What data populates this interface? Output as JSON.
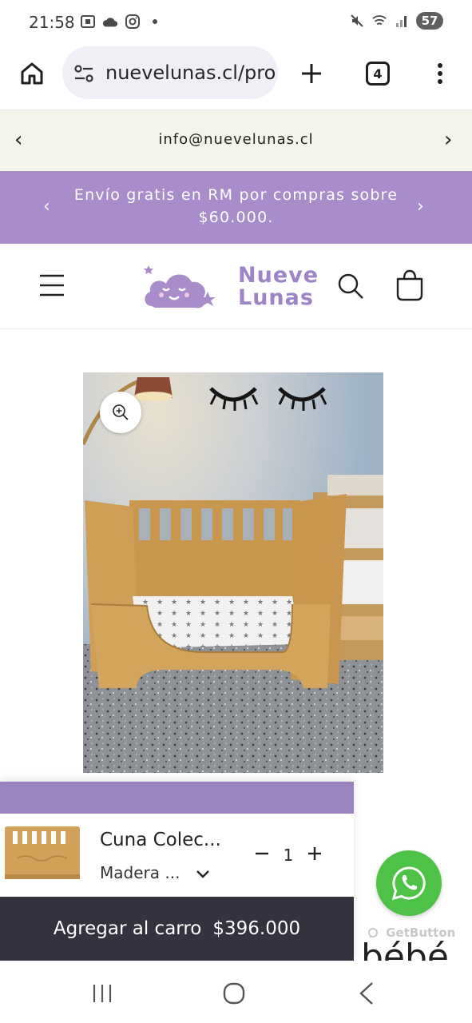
{
  "status_bar": {
    "time": "21:58",
    "battery": "57",
    "left_icons": [
      "screenshot-icon",
      "cloud-icon",
      "instagram-icon",
      "dot-icon"
    ],
    "right_icons": [
      "mute-icon",
      "wifi-icon",
      "signal-icon"
    ]
  },
  "browser": {
    "url": "nuevelunas.cl/pro",
    "tab_count": "4"
  },
  "announcement_1": {
    "text": "info@nuevelunas.cl",
    "prev": "‹",
    "next": "›"
  },
  "announcement_2": {
    "text": "Envío gratis en RM por compras sobre $60.000.",
    "prev": "‹",
    "next": "›"
  },
  "header": {
    "logo_text_line1": "Nueve",
    "logo_text_line2": "Lunas"
  },
  "product": {
    "image_icon": "crib-photo",
    "partial_heading": "bébé"
  },
  "sticky_cart": {
    "name": "Cuna Colec...",
    "variant": "Madera ...",
    "quantity": "1",
    "minus": "−",
    "plus": "+",
    "add_label": "Agregar al carro",
    "price": "$396.000"
  },
  "whatsapp": {
    "brand": "GetButton"
  },
  "colors": {
    "purple": "#a88dca",
    "purple_dark": "#9a83bf",
    "cream": "#f5f4ea",
    "dark_button": "#33323f",
    "whatsapp_green": "#4dc247"
  }
}
